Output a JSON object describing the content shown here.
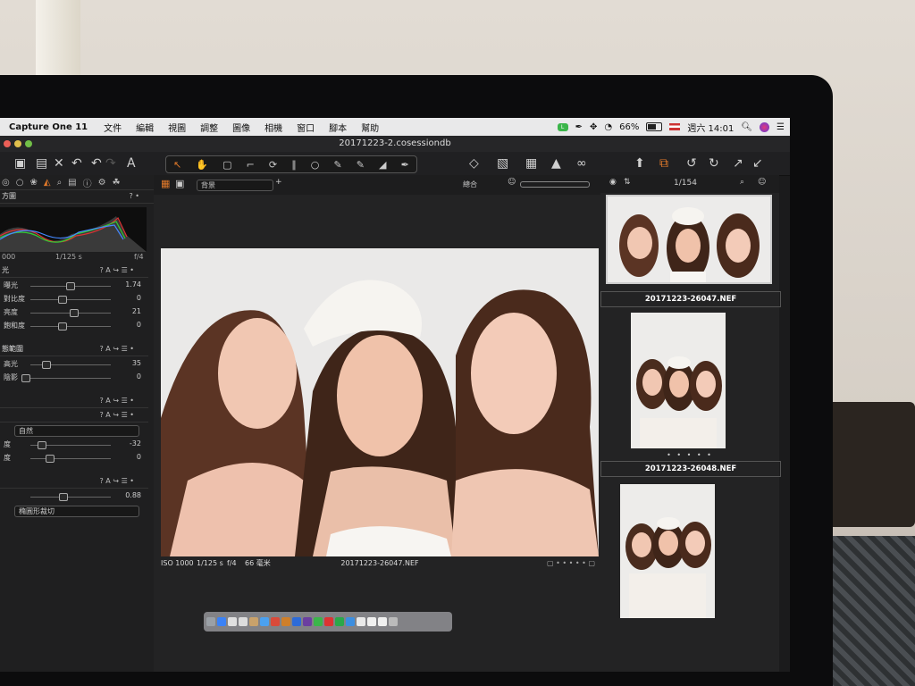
{
  "menubar": {
    "app_name": "Capture One 11",
    "items": [
      "文件",
      "編輯",
      "視圖",
      "調整",
      "圖像",
      "相機",
      "窗口",
      "腳本",
      "幫助"
    ],
    "status": {
      "battery_percent": "66%",
      "clock": "週六 14:01"
    }
  },
  "window": {
    "title": "20171223-2.cosessiondb"
  },
  "viewer": {
    "background_select": "背景",
    "rating_label": "總合",
    "photo": {
      "iso": "ISO 1000",
      "shutter": "1/125 s",
      "aperture": "f/4",
      "focal": "66 毫米",
      "filename": "20171223-26047.NEF"
    }
  },
  "browser": {
    "counter": "1/154",
    "thumbs": [
      {
        "filename": "20171223-26047.NEF"
      },
      {
        "filename": "20171223-26048.NEF"
      },
      {
        "filename": ""
      }
    ]
  },
  "left_panel": {
    "histogram_title": "方圖",
    "hist_readout": {
      "left": "000",
      "mid": "1/125 s",
      "right": "f/4"
    },
    "exposure_title": "光",
    "rows": [
      {
        "label": "曝光",
        "value": "1.74",
        "pos": 0.55
      },
      {
        "label": "對比度",
        "value": "0",
        "pos": 0.45
      },
      {
        "label": "亮度",
        "value": "21",
        "pos": 0.6
      },
      {
        "label": "飽和度",
        "value": "0",
        "pos": 0.45
      }
    ],
    "hdr_title": "態範圍",
    "hdr_rows": [
      {
        "label": "高光",
        "value": "35",
        "pos": 0.25
      },
      {
        "label": "陰影",
        "value": "0",
        "pos": 0.0
      }
    ],
    "clarity_method": "自然",
    "clarity_rows": [
      {
        "label": "度",
        "value": "-32",
        "pos": 0.2
      },
      {
        "label": "度",
        "value": "0",
        "pos": 0.3
      }
    ],
    "vignette_value": "0.88",
    "vignette_method": "橢圓形裁切"
  }
}
